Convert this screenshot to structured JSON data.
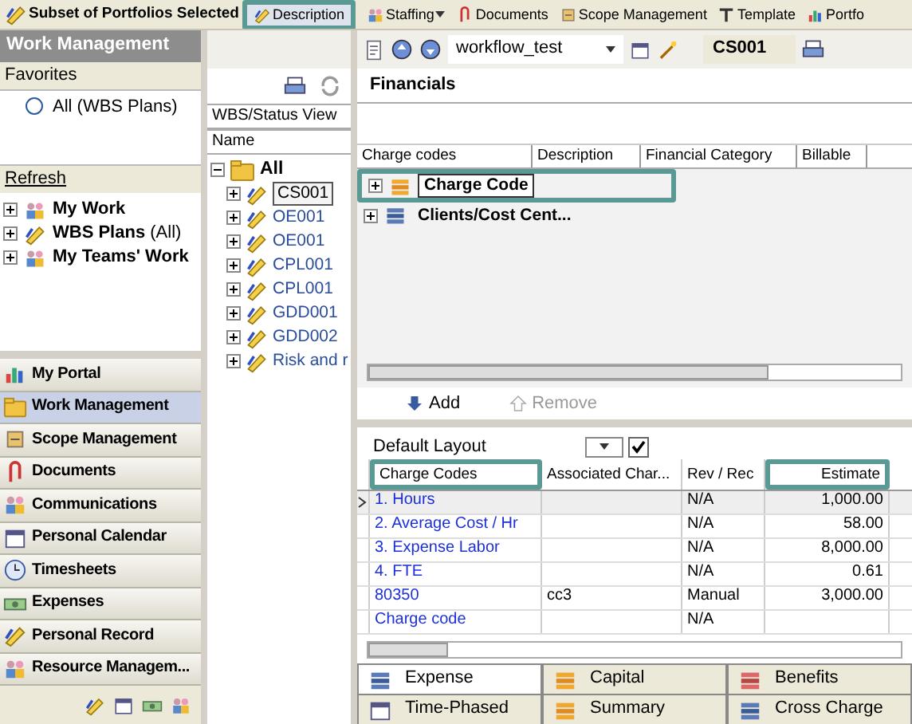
{
  "toolbar": {
    "title": "Subset of Portfolios Selected",
    "buttons": [
      {
        "label": "Description",
        "dropdown": false,
        "callout": true
      },
      {
        "label": "Staffing",
        "dropdown": true,
        "callout": false
      },
      {
        "label": "Documents",
        "dropdown": false,
        "callout": false
      },
      {
        "label": "Scope Management",
        "dropdown": false,
        "callout": false
      },
      {
        "label": "Template",
        "dropdown": false,
        "callout": false
      },
      {
        "label": "Portfo",
        "dropdown": false,
        "callout": false
      }
    ]
  },
  "sidebar": {
    "title": "Work Management",
    "favorites_label": "Favorites",
    "favorites": [
      {
        "label": "All (WBS Plans)",
        "selected": false
      }
    ],
    "refresh": "Refresh",
    "tree": [
      {
        "label": "My Work",
        "expanded": false
      },
      {
        "label": "WBS Plans",
        "suffix": "(All)",
        "expanded": false
      },
      {
        "label": "My Teams' Work",
        "expanded": false
      }
    ],
    "nav": [
      {
        "label": "My Portal",
        "selected": false
      },
      {
        "label": "Work Management",
        "selected": true
      },
      {
        "label": "Scope Management",
        "selected": false
      },
      {
        "label": "Documents",
        "selected": false
      },
      {
        "label": "Communications",
        "selected": false
      },
      {
        "label": "Personal Calendar",
        "selected": false
      },
      {
        "label": "Timesheets",
        "selected": false
      },
      {
        "label": "Expenses",
        "selected": false
      },
      {
        "label": "Personal Record",
        "selected": false
      },
      {
        "label": "Resource Managem...",
        "selected": false
      }
    ]
  },
  "wbs_panel": {
    "view": "WBS/Status View",
    "column": "Name",
    "tree": [
      {
        "label": "All",
        "expanded": true,
        "selected": false,
        "children": [
          {
            "label": "CS001",
            "expanded": false,
            "selected": true
          },
          {
            "label": "OE001",
            "expanded": false,
            "selected": false
          },
          {
            "label": "OE001",
            "expanded": false,
            "selected": false
          },
          {
            "label": "CPL001",
            "expanded": false,
            "selected": false
          },
          {
            "label": "CPL001",
            "expanded": false,
            "selected": false
          },
          {
            "label": "GDD001",
            "expanded": false,
            "selected": false
          },
          {
            "label": "GDD002",
            "expanded": false,
            "selected": false
          },
          {
            "label": "Risk and r",
            "expanded": false,
            "selected": false
          }
        ]
      }
    ]
  },
  "detail": {
    "workflow": "workflow_test",
    "code": "CS001",
    "section": "Financials",
    "charge_grid": {
      "columns": [
        "Charge codes",
        "Description",
        "Financial Category",
        "Billable"
      ],
      "rows": [
        {
          "label": "Charge Code",
          "expanded": false,
          "selected": true,
          "callout": true
        },
        {
          "label": "Clients/Cost Cent...",
          "expanded": false,
          "selected": false,
          "callout": false
        }
      ]
    },
    "actions": [
      {
        "label": "Add",
        "disabled": false
      },
      {
        "label": "Remove",
        "disabled": true
      }
    ],
    "estimate_grid": {
      "layout": "Default Layout",
      "columns": [
        {
          "label": "Charge Codes",
          "callout": true
        },
        {
          "label": "Associated Char...",
          "callout": false
        },
        {
          "label": "Rev / Rec",
          "callout": false
        },
        {
          "label": "Estimate",
          "callout": true
        }
      ],
      "rows": [
        {
          "charge_code": "1. Hours",
          "rev_rec": "N/A",
          "estimate": "1,000.00",
          "selected": true
        },
        {
          "charge_code": "2. Average Cost / Hr",
          "rev_rec": "N/A",
          "estimate": "58.00",
          "selected": false
        },
        {
          "charge_code": "3. Expense Labor",
          "rev_rec": "N/A",
          "estimate": "8,000.00",
          "selected": false
        },
        {
          "charge_code": "4. FTE",
          "rev_rec": "N/A",
          "estimate": "0.61",
          "selected": false
        },
        {
          "charge_code": "80350",
          "associated": "cc3",
          "rev_rec": "Manual",
          "estimate": "3,000.00",
          "selected": false
        },
        {
          "charge_code": "Charge code",
          "rev_rec": "N/A",
          "selected": false
        }
      ]
    },
    "tab_rows": [
      {
        "tabs": [
          {
            "label": "Expense",
            "selected": true
          },
          {
            "label": "Capital",
            "selected": false
          },
          {
            "label": "Benefits",
            "selected": false
          }
        ]
      },
      {
        "tabs": [
          {
            "label": "Time-Phased",
            "selected": false
          },
          {
            "label": "Summary",
            "selected": false
          },
          {
            "label": "Cross Charge",
            "selected": false
          }
        ]
      }
    ]
  }
}
